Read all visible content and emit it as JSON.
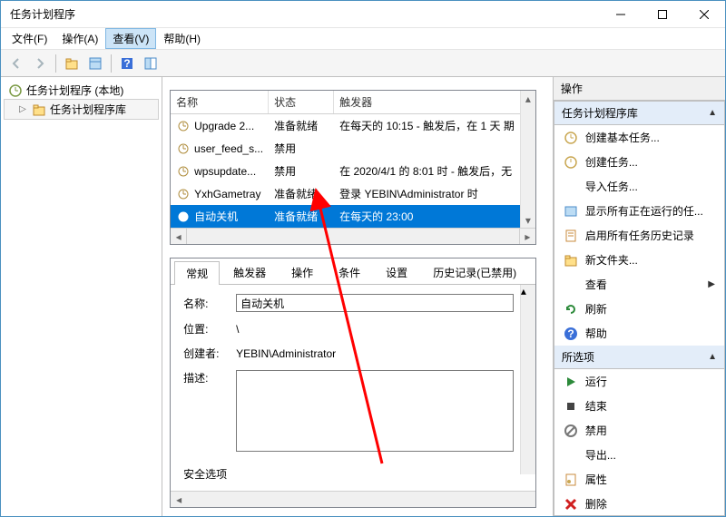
{
  "window": {
    "title": "任务计划程序"
  },
  "menu": {
    "file": "文件(F)",
    "action": "操作(A)",
    "view": "查看(V)",
    "help": "帮助(H)"
  },
  "tree": {
    "root": "任务计划程序 (本地)",
    "library": "任务计划程序库"
  },
  "list": {
    "headers": {
      "name": "名称",
      "status": "状态",
      "trigger": "触发器"
    },
    "rows": [
      {
        "name": "Upgrade 2...",
        "status": "准备就绪",
        "trigger": "在每天的 10:15 - 触发后，在 1 天 期"
      },
      {
        "name": "user_feed_s...",
        "status": "禁用",
        "trigger": ""
      },
      {
        "name": "wpsupdate...",
        "status": "禁用",
        "trigger": "在 2020/4/1 的 8:01 时 - 触发后，无"
      },
      {
        "name": "YxhGametray",
        "status": "准备就绪",
        "trigger": "登录 YEBIN\\Administrator 时"
      },
      {
        "name": "自动关机",
        "status": "准备就绪",
        "trigger": "在每天的 23:00"
      }
    ]
  },
  "detail": {
    "tabs": {
      "general": "常规",
      "triggers": "触发器",
      "actions": "操作",
      "conditions": "条件",
      "settings": "设置",
      "history": "历史记录(已禁用)"
    },
    "labels": {
      "name": "名称:",
      "location": "位置:",
      "author": "创建者:",
      "desc": "描述:"
    },
    "values": {
      "name": "自动关机",
      "location": "\\",
      "author": "YEBIN\\Administrator",
      "desc": ""
    },
    "bottom": "安全选项"
  },
  "actions": {
    "header": "操作",
    "section1": "任务计划程序库",
    "items1": {
      "create_basic": "创建基本任务...",
      "create": "创建任务...",
      "import": "导入任务...",
      "show_running": "显示所有正在运行的任...",
      "enable_history": "启用所有任务历史记录",
      "new_folder": "新文件夹...",
      "view": "查看",
      "refresh": "刷新",
      "help": "帮助"
    },
    "section2": "所选项",
    "items2": {
      "run": "运行",
      "end": "结束",
      "disable": "禁用",
      "export": "导出...",
      "properties": "属性",
      "delete": "删除"
    }
  }
}
